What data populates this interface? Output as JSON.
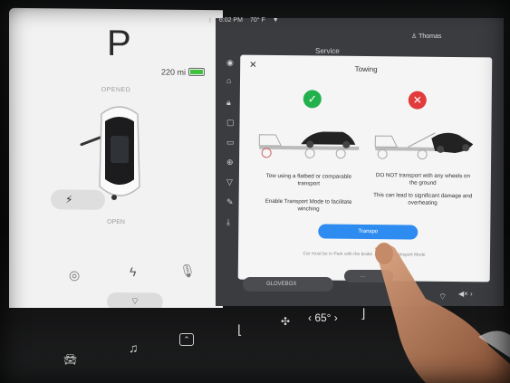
{
  "left_panel": {
    "gear": "P",
    "range": "220 mi",
    "battery_fill": 0.85,
    "opened_label": "OPENED",
    "open_label": "OPEN",
    "pager": "• • •"
  },
  "status_bar": {
    "time": "6:02 PM",
    "temp": "70° F",
    "user": "Thomas"
  },
  "service": {
    "title": "Service"
  },
  "dialog": {
    "close": "✕",
    "title": "Towing",
    "left_text_1": "Tow using a flatbed or comparable transport",
    "left_text_2": "Enable Transport Mode to facilitate winching",
    "right_text_1": "DO NOT transport with any wheels on the ground",
    "right_text_2": "This can lead to significant damage and overheating",
    "button_label": "Transpo",
    "footnote": "Car must be in Park with the brake ... enable Transport Mode"
  },
  "bottom": {
    "glovebox": "GLOVEBOX",
    "glovebox_right": "...",
    "temp": "‹ 65° ›"
  },
  "colors": {
    "check": "#23b14d",
    "x": "#e23b3b",
    "button": "#2e8cf0"
  },
  "icons": [
    "check-icon",
    "x-icon",
    "car-icon",
    "music-icon",
    "app-icon",
    "seat-heater-icon",
    "fan-icon",
    "lightning-icon",
    "mic-icon",
    "tire-icon",
    "wiper-icon",
    "close-icon",
    "user-icon",
    "wifi-icon"
  ]
}
